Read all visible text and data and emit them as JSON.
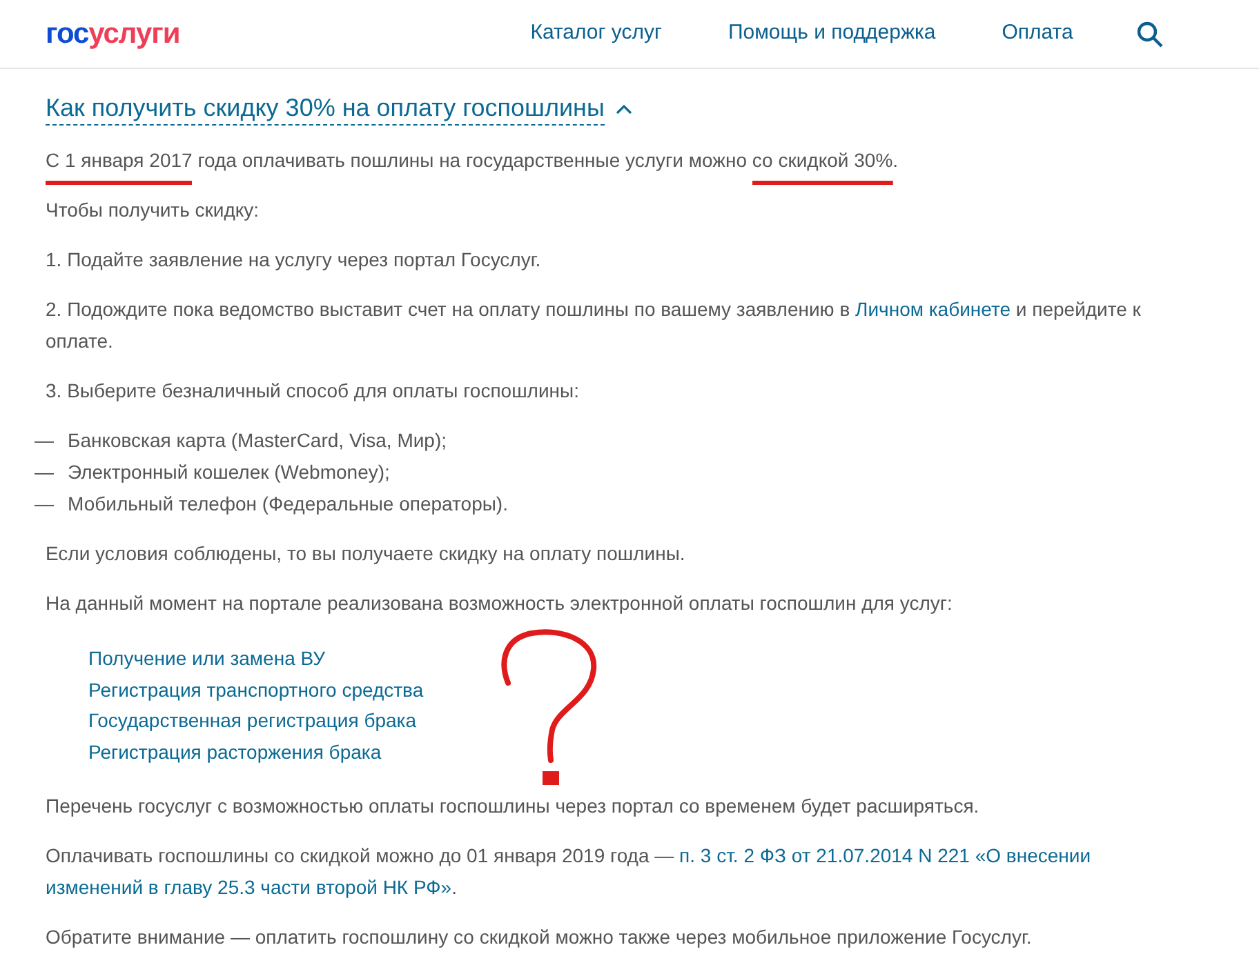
{
  "header": {
    "logo": [
      {
        "text": "гос",
        "color": "#0d4cd3"
      },
      {
        "text": "услуги",
        "color": "#ee3f58"
      }
    ],
    "nav": [
      "Каталог услуг",
      "Помощь и поддержка",
      "Оплата"
    ]
  },
  "section": {
    "title": "Как получить скидку 30% на оплату госпошлины",
    "expanded": true,
    "blocks": [
      {
        "kind": "paragraph",
        "parts": [
          {
            "text": "С 1 января 2017",
            "underlined": true
          },
          {
            "text": " года оплачивать пошлины на государственные услуги можно ",
            "underlined": false
          },
          {
            "text": "со скидкой 30%",
            "underlined": true
          },
          {
            "text": ".",
            "underlined": false
          }
        ]
      },
      {
        "kind": "paragraph",
        "parts": [
          {
            "text": "Чтобы получить скидку:"
          }
        ]
      },
      {
        "kind": "paragraph",
        "parts": [
          {
            "text": "1. Подайте заявление на услугу через портал Госуслуг."
          }
        ]
      },
      {
        "kind": "paragraph",
        "parts": [
          {
            "text": "2. Подождите пока ведомство выставит счет на оплату пошлины по вашему заявлению в "
          },
          {
            "text": "Личном кабинете",
            "link": true
          },
          {
            "text": " и перейдите к оплате."
          }
        ]
      },
      {
        "kind": "paragraph",
        "parts": [
          {
            "text": "3. Выберите безналичный способ для оплаты госпошлины:"
          }
        ]
      },
      {
        "kind": "dash_list",
        "items": [
          {
            "dash": "—",
            "text": "Банковская карта (MasterCard, Visa, Мир);"
          },
          {
            "dash": "—",
            "text": "Электронный кошелек (Webmoney);"
          },
          {
            "dash": "—",
            "text": "Мобильный телефон (Федеральные операторы)."
          }
        ]
      },
      {
        "kind": "paragraph",
        "parts": [
          {
            "text": "Если условия соблюдены, то вы получаете скидку на оплату пошлины."
          }
        ]
      },
      {
        "kind": "paragraph",
        "parts": [
          {
            "text": "На данный момент на портале реализована возможность электронной оплаты госпошлин для услуг:"
          }
        ]
      },
      {
        "kind": "link_list",
        "items": [
          "Получение или замена ВУ",
          "Регистрация транспортного средства",
          "Государственная регистрация брака",
          "Регистрация расторжения брака"
        ]
      },
      {
        "kind": "paragraph",
        "parts": [
          {
            "text": "Перечень госуслуг с возможностью оплаты госпошлины через портал со временем будет расширяться."
          }
        ]
      },
      {
        "kind": "paragraph",
        "parts": [
          {
            "text": "Оплачивать госпошлины со скидкой можно до 01 января 2019 года — "
          },
          {
            "text": "п. 3 ст. 2 ФЗ от 21.07.2014 N 221 «О внесении",
            "link": true
          },
          {
            "text": "изменений в главу 25.3 части второй НК РФ»",
            "link": true
          },
          {
            "text": "."
          }
        ]
      },
      {
        "kind": "paragraph",
        "parts": [
          {
            "text": "Обратите внимание — оплатить госпошлину со скидкой можно также через мобильное приложение Госуслуг."
          }
        ]
      }
    ]
  }
}
